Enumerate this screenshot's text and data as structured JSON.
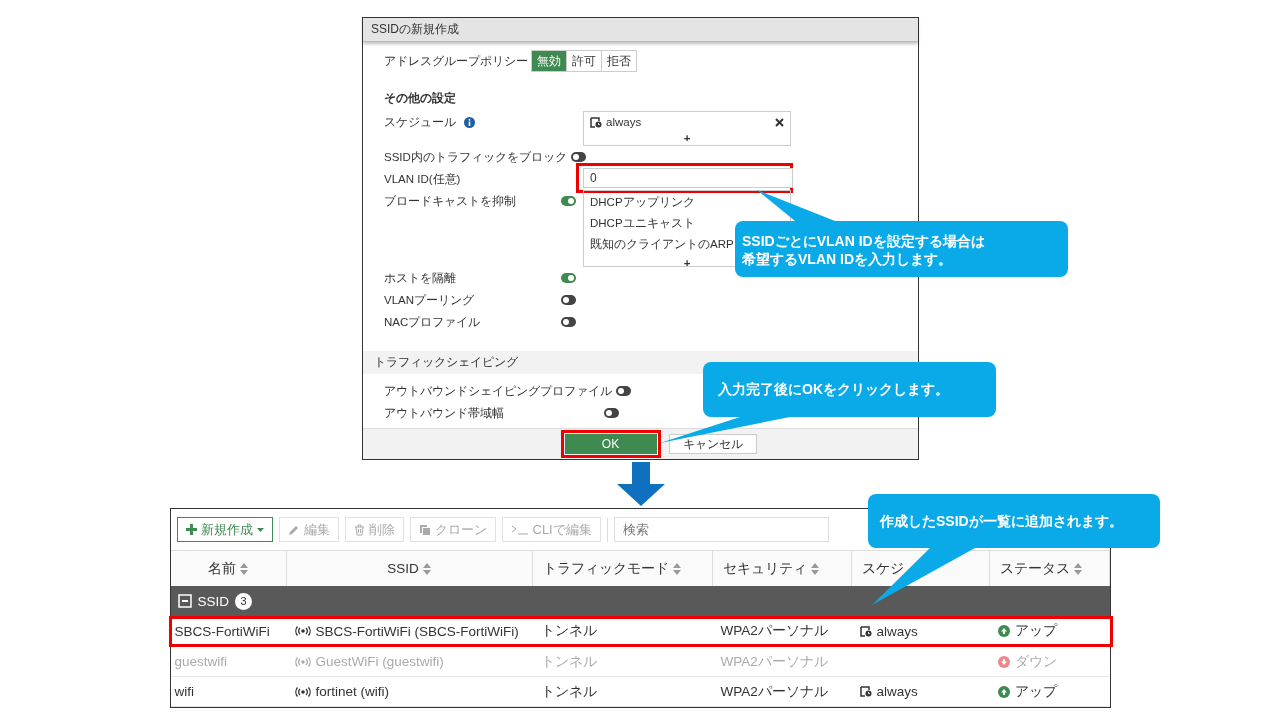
{
  "dialog": {
    "title": "SSIDの新規作成",
    "address_group_policy": {
      "label": "アドレスグループポリシー",
      "options": [
        {
          "label": "無効",
          "selected": true
        },
        {
          "label": "許可",
          "selected": false
        },
        {
          "label": "拒否",
          "selected": false
        }
      ]
    },
    "section_heading": "その他の設定",
    "settings": [
      {
        "kind": "list",
        "label": "スケジュール",
        "info": true,
        "entries": [
          {
            "text": "always",
            "removable": true
          }
        ],
        "add_label": "+"
      },
      {
        "kind": "toggle",
        "label": "SSID内のトラフィックをブロック",
        "on": false
      },
      {
        "kind": "input",
        "label": "VLAN ID(任意)",
        "value": "0",
        "highlighted": true
      },
      {
        "kind": "toggle_list",
        "label": "ブロードキャストを抑制",
        "on": true,
        "items": [
          "DHCPアップリンク",
          "DHCPユニキャスト",
          "既知のクライアントのARP"
        ],
        "add_label": "+"
      },
      {
        "kind": "toggle",
        "label": "ホストを隔離",
        "on": true
      },
      {
        "kind": "toggle",
        "label": "VLANプーリング",
        "on": false
      },
      {
        "kind": "toggle",
        "label": "NACプロファイル",
        "on": false
      }
    ],
    "traffic_shaping": {
      "heading": "トラフィックシェイピング",
      "settings": [
        {
          "kind": "toggle",
          "label": "アウトバウンドシェイピングプロファイル",
          "on": false
        },
        {
          "kind": "toggle",
          "label": "アウトバウンド帯域幅",
          "on": false
        }
      ]
    },
    "buttons": [
      {
        "label": "OK",
        "kind": "primary",
        "highlighted": true
      },
      {
        "label": "キャンセル",
        "kind": "secondary",
        "highlighted": false
      }
    ]
  },
  "table": {
    "toolbar": [
      {
        "label": "新規作成",
        "kind": "create",
        "disabled": false
      },
      {
        "label": "編集",
        "kind": "edit",
        "disabled": true
      },
      {
        "label": "削除",
        "kind": "delete",
        "disabled": true
      },
      {
        "label": "クローン",
        "kind": "clone",
        "disabled": true
      },
      {
        "label": "CLIで編集",
        "kind": "cli",
        "disabled": true
      }
    ],
    "search": {
      "placeholder": "検索"
    },
    "columns": [
      "名前",
      "SSID",
      "トラフィックモード",
      "セキュリティ",
      "スケジ",
      "ステータス"
    ],
    "group": {
      "label": "SSID",
      "count": "3",
      "expanded": true
    },
    "rows": [
      {
        "name": "SBCS-FortiWiFi",
        "ssid": "SBCS-FortiWiFi (SBCS-FortiWiFi)",
        "mode": "トンネル",
        "security": "WPA2パーソナル",
        "schedule": "always",
        "status": {
          "kind": "up",
          "label": "アップ"
        },
        "disabled": false,
        "highlighted": true
      },
      {
        "name": "guestwifi",
        "ssid": "GuestWiFi (guestwifi)",
        "mode": "トンネル",
        "security": "WPA2パーソナル",
        "status": {
          "kind": "down",
          "label": "ダウン"
        },
        "disabled": true,
        "highlighted": false
      },
      {
        "name": "wifi",
        "ssid": "fortinet (wifi)",
        "mode": "トンネル",
        "security": "WPA2パーソナル",
        "schedule": "always",
        "status": {
          "kind": "up",
          "label": "アップ"
        },
        "disabled": false,
        "highlighted": false
      }
    ]
  },
  "callouts": [
    {
      "lines": [
        "SSIDごとにVLAN IDを設定する場合は",
        "希望するVLAN IDを入力します。"
      ]
    },
    {
      "lines": [
        "入力完了後にOKをクリックします。"
      ]
    },
    {
      "lines": [
        "作成したSSIDが一覧に追加されます。"
      ]
    }
  ]
}
